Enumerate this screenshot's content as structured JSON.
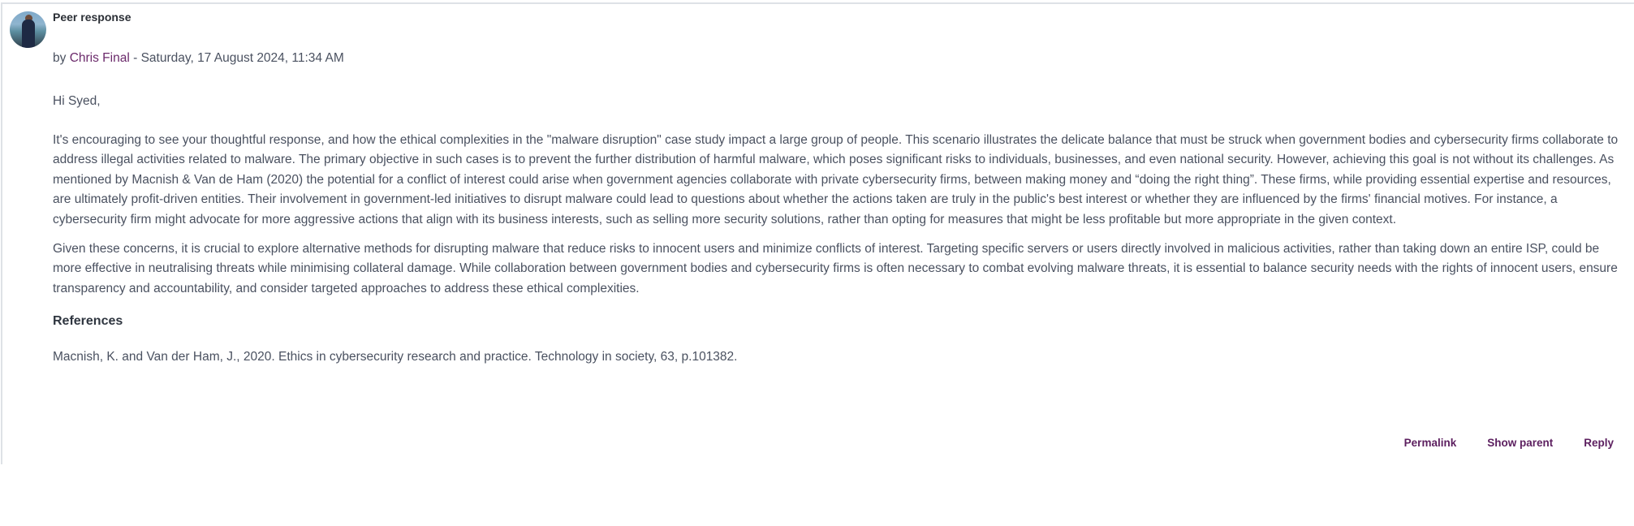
{
  "post": {
    "subject": "Peer response",
    "byline": {
      "prefix": "by",
      "author": "Chris Final",
      "separator": "-",
      "date": "Saturday, 17 August 2024, 11:34 AM"
    },
    "greeting": "Hi Syed,",
    "paragraphs": [
      "It's encouraging to see your thoughtful response, and how the ethical complexities in the \"malware disruption\" case study impact a large group of people. This scenario illustrates the delicate balance that must be struck when government bodies and cybersecurity firms collaborate to address illegal activities related to malware. The primary objective in such cases is to prevent the further distribution of harmful malware, which poses significant risks to individuals, businesses, and even national security. However, achieving this goal is not without its challenges. As mentioned by Macnish & Van de Ham (2020) the potential for a conflict of interest could arise when government agencies collaborate with private cybersecurity firms, between making money and “doing the right thing”. These firms, while providing essential expertise and resources, are ultimately profit-driven entities. Their involvement in government-led initiatives to disrupt malware could lead to questions about whether the actions taken are truly in the public's best interest or whether they are influenced by the firms' financial motives. For instance, a cybersecurity firm might advocate for more aggressive actions that align with its business interests, such as selling more security solutions, rather than opting for measures that might be less profitable but more appropriate in the given context.",
      "Given these concerns, it is crucial to explore alternative methods for disrupting malware that reduce risks to innocent users and minimize conflicts of interest. Targeting specific servers or users directly involved in malicious activities, rather than taking down an entire ISP, could be more effective in neutralising threats while minimising collateral damage. While collaboration between government bodies and cybersecurity firms is often necessary to combat evolving malware threats, it is essential to balance security needs with the rights of innocent users, ensure transparency and accountability, and consider targeted approaches to address these ethical complexities."
    ],
    "references_heading": "References",
    "references": [
      "Macnish, K. and Van der Ham, J., 2020. Ethics in cybersecurity research and practice. Technology in society, 63, p.101382."
    ],
    "actions": {
      "permalink": "Permalink",
      "show_parent": "Show parent",
      "reply": "Reply"
    }
  },
  "colors": {
    "link": "#6b2a6b",
    "text": "#4a5160",
    "border": "#dee2e6"
  }
}
